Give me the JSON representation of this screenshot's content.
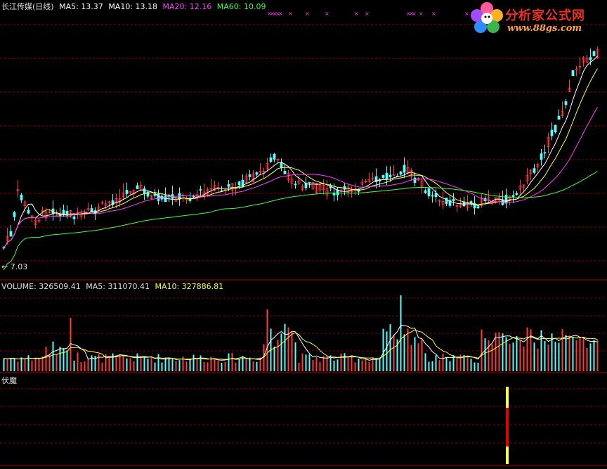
{
  "price_panel": {
    "title": "长江传媒(日线)",
    "indicators": [
      {
        "label": "MA5: 13.37",
        "color": "#ffffff"
      },
      {
        "label": "MA10: 13.18",
        "color": "#ffffff"
      },
      {
        "label": "MA20: 12.16",
        "color": "#ff40ff"
      },
      {
        "label": "MA60: 10.09",
        "color": "#40ff40"
      }
    ],
    "low_label": "← 7.03"
  },
  "volume_panel": {
    "indicators": [
      {
        "label": "VOLUME: 326509.41",
        "color": "#e0e0e0"
      },
      {
        "label": "MA5: 311070.41",
        "color": "#e0e0e0"
      },
      {
        "label": "MA10: 327886.81",
        "color": "#ffff40"
      }
    ]
  },
  "signal_panel": {
    "title": "伏魔"
  },
  "logo": {
    "text": "分析家公式网",
    "url": "www.88gs.com"
  },
  "colors": {
    "up": "#ff3c3c",
    "down": "#54ffff",
    "grid": "#8b0000",
    "ma5": "#ffffff",
    "ma10": "#ffff40",
    "ma20": "#ff40ff",
    "ma60": "#40ff40",
    "marker": "#ff40ff"
  }
}
